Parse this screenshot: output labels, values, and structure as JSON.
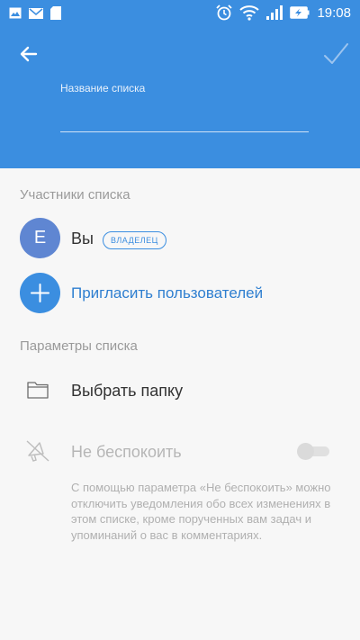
{
  "status_bar": {
    "time": "19:08",
    "icons": [
      "image-icon",
      "mail-icon",
      "sd-card-icon",
      "alarm-icon",
      "wifi-icon",
      "signal-icon",
      "battery-charging-icon"
    ]
  },
  "header": {
    "field_label": "Название списка",
    "field_value": "",
    "accent": "#3b8ee0"
  },
  "members": {
    "section_title": "Участники списка",
    "member": {
      "initial": "E",
      "name": "Вы",
      "badge": "ВЛАДЕЛЕЦ"
    },
    "invite_label": "Пригласить пользователей"
  },
  "settings": {
    "section_title": "Параметры списка",
    "folder_label": "Выбрать папку",
    "dnd_label": "Не беспокоить",
    "dnd_enabled": false,
    "dnd_description": "С помощью параметра «Не беспокоить» можно отключить уведомления обо всех изменениях в этом списке, кроме порученных вам задач и упоминаний о вас в комментариях."
  }
}
